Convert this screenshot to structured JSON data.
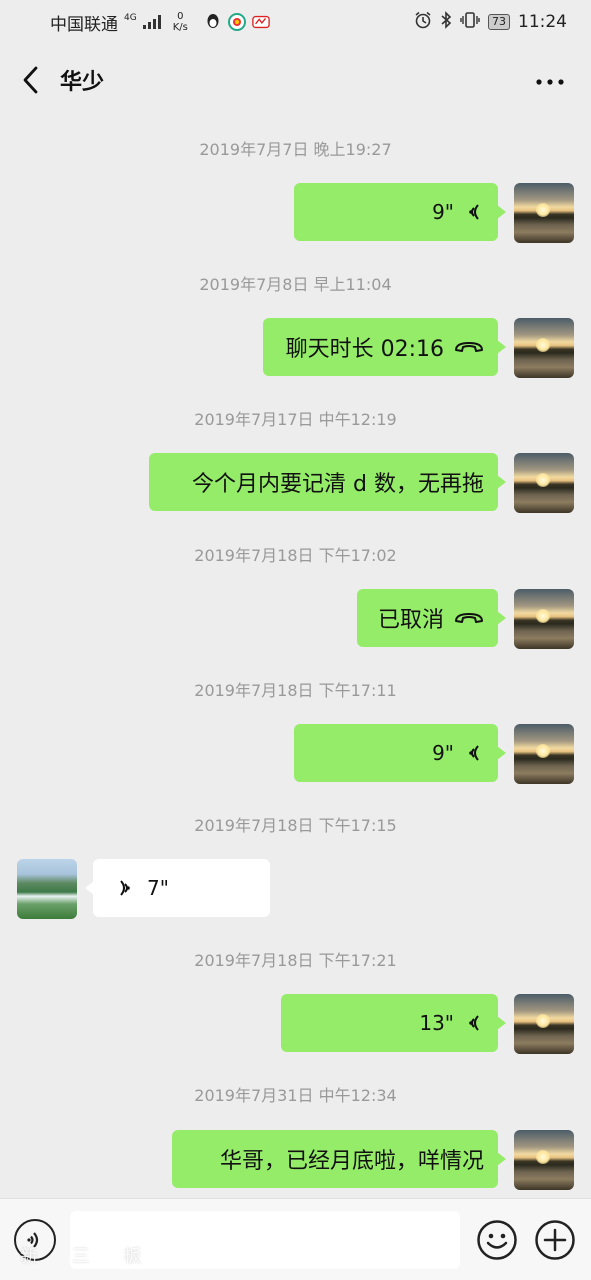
{
  "status_bar": {
    "carrier": "中国联通",
    "network": "4G",
    "net_speed_value": "0",
    "net_speed_unit": "K/s",
    "battery": "73",
    "time": "11:24"
  },
  "header": {
    "title": "华少"
  },
  "messages": [
    {
      "timestamp": "2019年7月7日 晚上19:27",
      "side": "sent",
      "kind": "voice",
      "text": "9\""
    },
    {
      "timestamp": "2019年7月8日 早上11:04",
      "side": "sent",
      "kind": "call",
      "text": "聊天时长 02:16"
    },
    {
      "timestamp": "2019年7月17日 中午12:19",
      "side": "sent",
      "kind": "text",
      "text": "今个月内要记清 d 数，无再拖"
    },
    {
      "timestamp": "2019年7月18日 下午17:02",
      "side": "sent",
      "kind": "call",
      "text": "已取消"
    },
    {
      "timestamp": "2019年7月18日 下午17:11",
      "side": "sent",
      "kind": "voice",
      "text": "9\""
    },
    {
      "timestamp": "2019年7月18日 下午17:15",
      "side": "received",
      "kind": "voice",
      "text": "7\""
    },
    {
      "timestamp": "2019年7月18日 下午17:21",
      "side": "sent",
      "kind": "voice",
      "text": "13\""
    },
    {
      "timestamp": "2019年7月31日 中午12:34",
      "side": "sent",
      "kind": "text",
      "text": "华哥，已经月底啦，咩情况"
    }
  ],
  "input_bar": {
    "placeholder": "",
    "watermark": "新 三 板"
  },
  "colors": {
    "sent_bubble": "#95ec69",
    "received_bubble": "#ffffff",
    "background": "#ededed"
  }
}
